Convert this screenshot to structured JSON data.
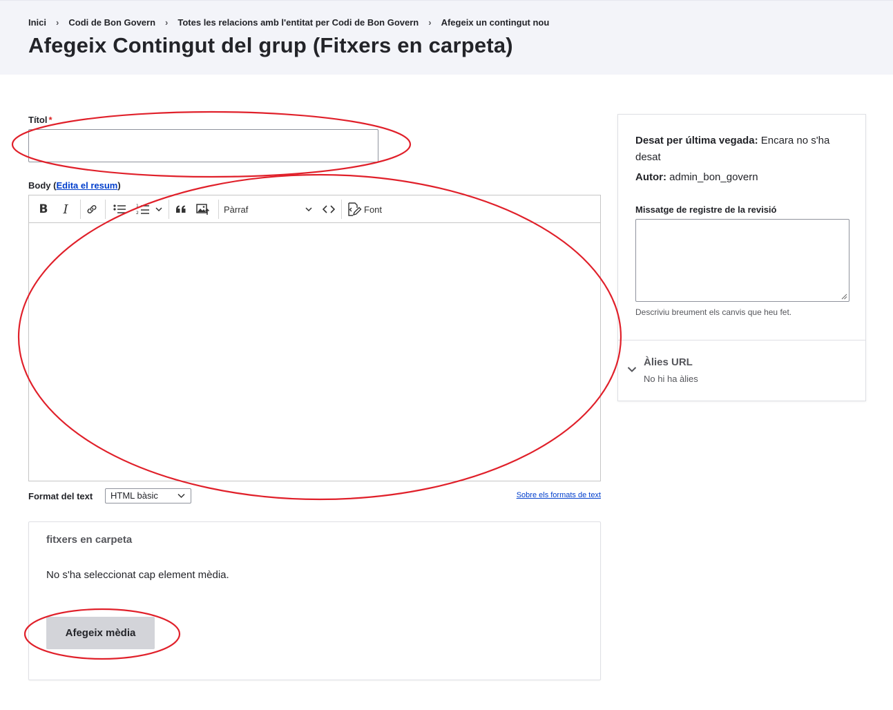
{
  "breadcrumb": {
    "items": [
      "Inici",
      "Codi de Bon Govern",
      "Totes les relacions amb l'entitat per Codi de Bon Govern",
      "Afegeix un contingut nou"
    ],
    "separator": "›"
  },
  "page": {
    "title": "Afegeix Contingut del grup (Fitxers en carpeta)"
  },
  "form": {
    "title_label": "Títol",
    "required_mark": "*",
    "title_value": "",
    "body_label": "Body",
    "body_summary_open": "(",
    "body_summary_link": "Edita el resum",
    "body_summary_close": ")",
    "toolbar": {
      "bold": "B",
      "italic": "I",
      "paragraph": "Pàrraf",
      "source_label": "Font"
    },
    "text_format_label": "Format del text",
    "text_format_value": "HTML bàsic",
    "text_format_help": "Sobre els formats de text"
  },
  "media": {
    "title": "fitxers en carpeta",
    "empty_text": "No s'ha seleccionat cap element mèdia.",
    "add_button": "Afegeix mèdia"
  },
  "sidebar": {
    "last_saved_label": "Desat per última vegada:",
    "last_saved_value": "Encara no s'ha desat",
    "author_label": "Autor:",
    "author_value": "admin_bon_govern",
    "revision_label": "Missatge de registre de la revisió",
    "revision_value": "",
    "revision_desc": "Descriviu breument els canvis que heu fet.",
    "alias_title": "Àlies URL",
    "alias_sub": "No hi ha àlies"
  },
  "colors": {
    "header_bg": "#f3f4f9",
    "link": "#003ecc",
    "required": "#dc2323",
    "annotation": "#e0202a",
    "button_bg": "#d3d4d9"
  }
}
